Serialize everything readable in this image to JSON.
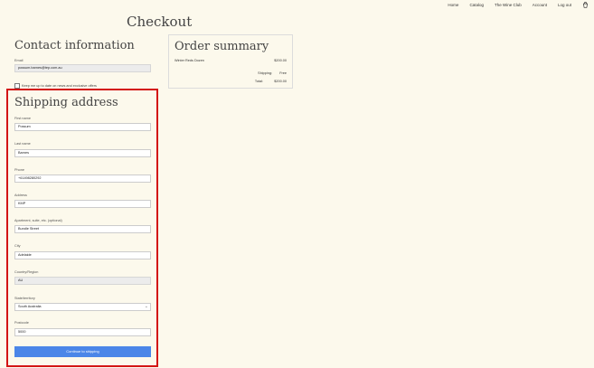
{
  "nav": {
    "items": [
      "Home",
      "Catalog",
      "The Wine Club",
      "Account",
      "Log out"
    ]
  },
  "icons": {
    "cart": "cart-icon"
  },
  "page_title": "Checkout",
  "contact": {
    "heading": "Contact information",
    "email_label": "Email",
    "email_value": "possum.barnes@tep.com.au",
    "newsletter_label": "Keep me up to date on news and exclusive offers"
  },
  "shipping": {
    "heading": "Shipping address",
    "first_name_label": "First name",
    "first_name_value": "Possum",
    "last_name_label": "Last name",
    "last_name_value": "Barnes",
    "phone_label": "Phone",
    "phone_value": "+61498280292",
    "address_label": "Address",
    "address_value": "KMP",
    "apartment_label": "Apartment, suite, etc. (optional)",
    "apartment_value": "Bundle Street",
    "city_label": "City",
    "city_value": "Adelaide",
    "country_label": "Country/Region",
    "country_value": "AU",
    "state_label": "State/territory",
    "state_value": "South Australia",
    "postcode_label": "Postcode",
    "postcode_value": "5000",
    "continue_label": "Continue to shipping"
  },
  "summary": {
    "heading": "Order summary",
    "item_name": "Winter Reds Dozen",
    "item_price": "$200.00",
    "shipping_label": "Shipping:",
    "shipping_value": "Free",
    "total_label": "Total:",
    "total_value": "$200.00"
  },
  "colors": {
    "accent": "#4b86e8",
    "highlight": "#d31414",
    "background": "#fcf9ec"
  }
}
